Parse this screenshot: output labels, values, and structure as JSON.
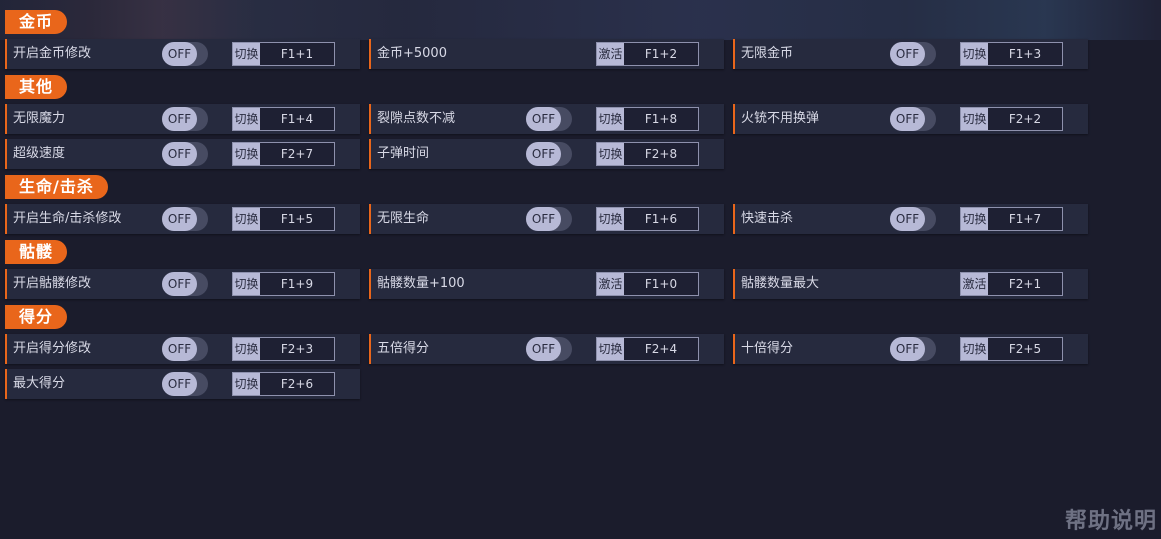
{
  "sections": [
    {
      "title": "金币",
      "items": [
        {
          "label": "开启金币修改",
          "toggle": "OFF",
          "action": "切换",
          "key": "F1+1"
        },
        {
          "label": "金币+5000",
          "toggle": null,
          "action": "激活",
          "key": "F1+2"
        },
        {
          "label": "无限金币",
          "toggle": "OFF",
          "action": "切换",
          "key": "F1+3"
        }
      ]
    },
    {
      "title": "其他",
      "items": [
        {
          "label": "无限魔力",
          "toggle": "OFF",
          "action": "切换",
          "key": "F1+4"
        },
        {
          "label": "裂隙点数不减",
          "toggle": "OFF",
          "action": "切换",
          "key": "F1+8"
        },
        {
          "label": "火铳不用换弹",
          "toggle": "OFF",
          "action": "切换",
          "key": "F2+2"
        },
        {
          "label": "超级速度",
          "toggle": "OFF",
          "action": "切换",
          "key": "F2+7"
        },
        {
          "label": "子弹时间",
          "toggle": "OFF",
          "action": "切换",
          "key": "F2+8"
        }
      ]
    },
    {
      "title": "生命/击杀",
      "items": [
        {
          "label": "开启生命/击杀修改",
          "toggle": "OFF",
          "action": "切换",
          "key": "F1+5"
        },
        {
          "label": "无限生命",
          "toggle": "OFF",
          "action": "切换",
          "key": "F1+6"
        },
        {
          "label": "快速击杀",
          "toggle": "OFF",
          "action": "切换",
          "key": "F1+7"
        }
      ]
    },
    {
      "title": "骷髅",
      "items": [
        {
          "label": "开启骷髅修改",
          "toggle": "OFF",
          "action": "切换",
          "key": "F1+9"
        },
        {
          "label": "骷髅数量+100",
          "toggle": null,
          "action": "激活",
          "key": "F1+0"
        },
        {
          "label": "骷髅数量最大",
          "toggle": null,
          "action": "激活",
          "key": "F2+1"
        }
      ]
    },
    {
      "title": "得分",
      "items": [
        {
          "label": "开启得分修改",
          "toggle": "OFF",
          "action": "切换",
          "key": "F2+3"
        },
        {
          "label": "五倍得分",
          "toggle": "OFF",
          "action": "切换",
          "key": "F2+4"
        },
        {
          "label": "十倍得分",
          "toggle": "OFF",
          "action": "切换",
          "key": "F2+5"
        },
        {
          "label": "最大得分",
          "toggle": "OFF",
          "action": "切换",
          "key": "F2+6"
        }
      ]
    }
  ],
  "help_label": "帮助说明",
  "colors": {
    "accent": "#e9661b",
    "panel": "#262a3e",
    "background": "#1b1c2c"
  }
}
